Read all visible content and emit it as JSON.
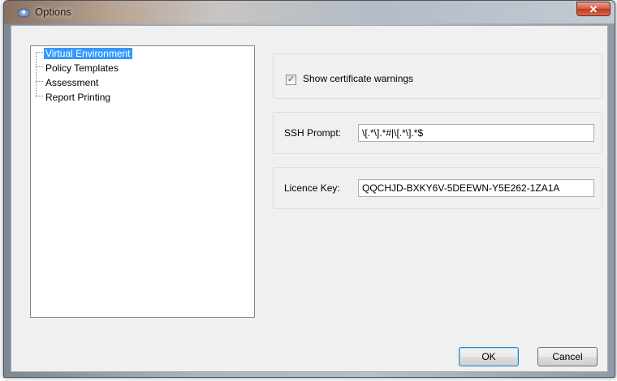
{
  "window": {
    "title": "Options",
    "close_glyph": "✕"
  },
  "tree": {
    "items": [
      {
        "label": "Virtual Environment",
        "selected": true
      },
      {
        "label": "Policy Templates",
        "selected": false
      },
      {
        "label": "Assessment",
        "selected": false
      },
      {
        "label": "Report Printing",
        "selected": false
      }
    ]
  },
  "settings": {
    "certificate_warnings": {
      "label": "Show certificate warnings",
      "checked": true,
      "check_glyph": "✓"
    },
    "ssh_prompt": {
      "label": "SSH Prompt:",
      "value": "\\[.*\\].*#|\\[.*\\].*$"
    },
    "licence_key": {
      "label": "Licence Key:",
      "value": "QQCHJD-BXKY6V-5DEEWN-Y5E262-1ZA1A"
    }
  },
  "buttons": {
    "ok": "OK",
    "cancel": "Cancel"
  },
  "icons": {
    "app": "options-app-icon",
    "close": "close-icon",
    "checkbox": "checkmark-icon"
  },
  "colors": {
    "selection": "#3399ff",
    "close_button": "#c23b1f",
    "dialog_bg": "#f0f0f0"
  }
}
